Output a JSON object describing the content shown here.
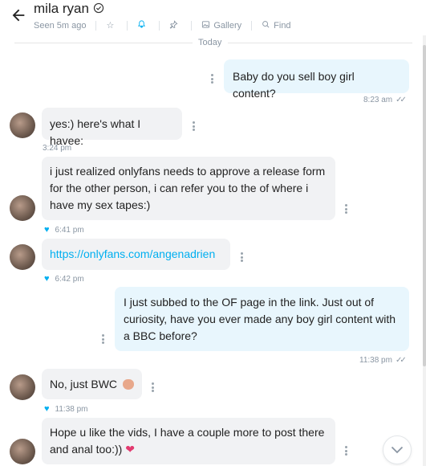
{
  "header": {
    "name": "mila ryan",
    "seen": "Seen 5m ago",
    "gallery": "Gallery",
    "find": "Find"
  },
  "day_label": "Today",
  "messages": [
    {
      "dir": "out",
      "text": "Baby do you sell boy girl content?",
      "time": "8:23 am"
    },
    {
      "dir": "in",
      "text": "yes:) here's what I havee:",
      "time": "3:24 pm"
    },
    {
      "dir": "in",
      "text": "i just realized onlyfans needs to approve a release form for the other person, i can refer you to the of where i have my sex tapes:)",
      "time": "6:41 pm"
    },
    {
      "dir": "in",
      "text": "https://onlyfans.com/angenadrien",
      "time": "6:42 pm"
    },
    {
      "dir": "out",
      "text": "I just subbed to the OF page in the link. Just out of curiosity, have you ever made any boy girl content with a BBC before?",
      "time": "11:38 pm"
    },
    {
      "dir": "in",
      "text": "No, just BWC",
      "time": "11:38 pm"
    },
    {
      "dir": "in",
      "text": "Hope u like the vids, I have a couple more to post there and anal too:))",
      "time": ""
    }
  ],
  "icons": {
    "back": "arrow-left-icon",
    "verified": "verified-badge-icon",
    "star": "star-icon",
    "bell": "bell-icon",
    "pin": "pin-icon",
    "gallery": "image-icon",
    "find": "search-icon",
    "scroll_down": "chevron-down-icon"
  },
  "colors": {
    "accent": "#00aff0",
    "incoming_bubble": "#f1f2f4",
    "outgoing_bubble": "#e8f6fd",
    "muted_text": "#8a96a3"
  }
}
